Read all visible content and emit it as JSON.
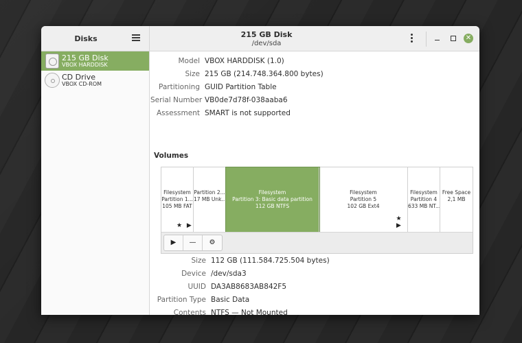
{
  "sidebar": {
    "title": "Disks",
    "items": [
      {
        "name": "215 GB Disk",
        "sub": "VBOX HARDDISK",
        "selected": true,
        "icon": "hard-disk-icon"
      },
      {
        "name": "CD Drive",
        "sub": "VBOX CD-ROM",
        "selected": false,
        "icon": "optical-disc-icon"
      }
    ]
  },
  "header": {
    "title": "215 GB Disk",
    "subtitle": "/dev/sda",
    "close_glyph": "✕"
  },
  "disk_props": {
    "model_label": "Model",
    "model": "VBOX HARDDISK (1.0)",
    "size_label": "Size",
    "size": "215 GB (214.748.364.800 bytes)",
    "partitioning_label": "Partitioning",
    "partitioning": "GUID Partition Table",
    "serial_label": "Serial Number",
    "serial": "VB0de7d78f-038aaba6",
    "assessment_label": "Assessment",
    "assessment": "SMART is not supported"
  },
  "volumes": {
    "label": "Volumes",
    "partitions": [
      {
        "l1": "Filesystem",
        "l2": "Partition 1...",
        "l3": "105 MB FAT",
        "marks": "★ ▶"
      },
      {
        "l1": "",
        "l2": "Partition 2...",
        "l3": "17 MB Unk...",
        "marks": ""
      },
      {
        "l1": "Filesystem",
        "l2": "Partition 3: Basic data partition",
        "l3": "112 GB NTFS",
        "marks": ""
      },
      {
        "l1": "Filesystem",
        "l2": "Partition 5",
        "l3": "102 GB Ext4",
        "marks": "★ ▶"
      },
      {
        "l1": "Filesystem",
        "l2": "Partition 4",
        "l3": "633 MB NT...",
        "marks": ""
      },
      {
        "l1": "Free Space",
        "l2": "2,1 MB",
        "l3": "",
        "marks": ""
      }
    ],
    "toolbar": {
      "play": "▶",
      "minus": "—",
      "gear": "⚙"
    }
  },
  "partition_props": {
    "size_label": "Size",
    "size": "112 GB (111.584.725.504 bytes)",
    "device_label": "Device",
    "device": "/dev/sda3",
    "uuid_label": "UUID",
    "uuid": "DA3AB8683AB842F5",
    "type_label": "Partition Type",
    "type": "Basic Data",
    "contents_label": "Contents",
    "contents": "NTFS — Not Mounted"
  },
  "colors": {
    "accent": "#86ad61"
  }
}
